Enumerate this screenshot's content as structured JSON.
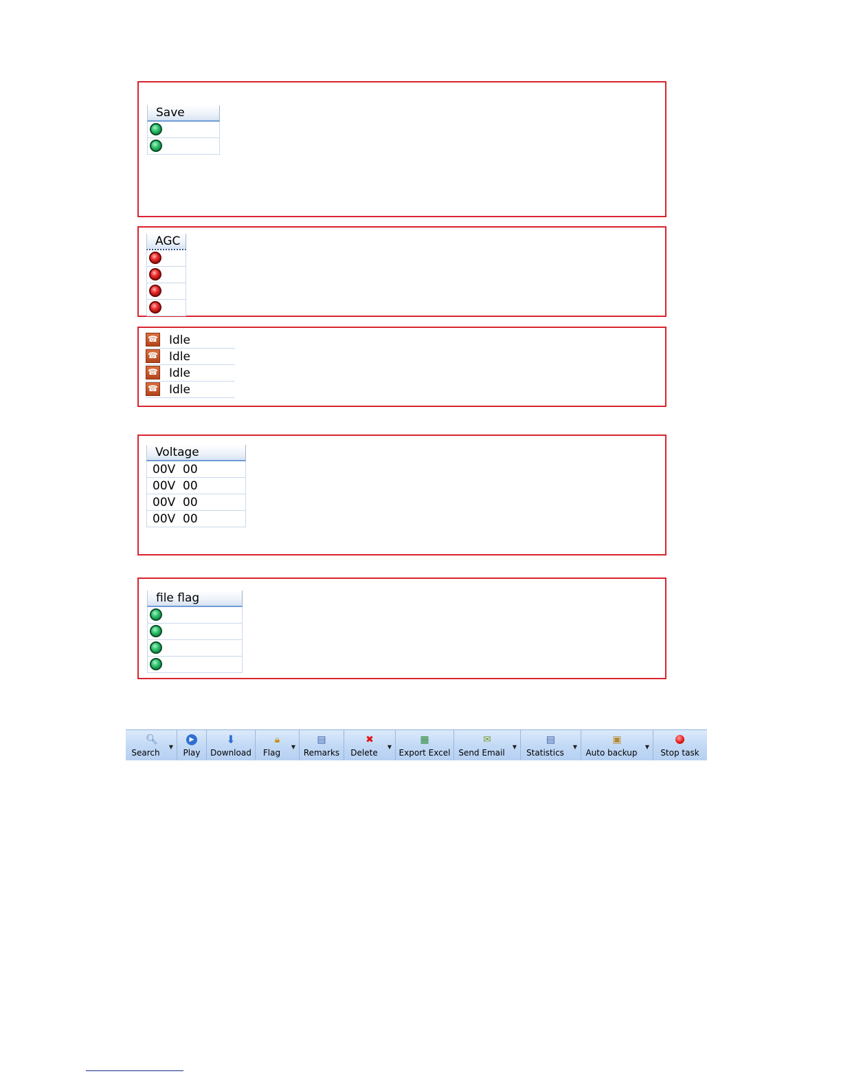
{
  "save_panel": {
    "header": "Save",
    "rows": [
      "green",
      "green"
    ]
  },
  "agc_panel": {
    "header": "AGC",
    "rows": [
      "red",
      "red",
      "red",
      "red"
    ]
  },
  "status_panel": {
    "rows": [
      "Idle",
      "Idle",
      "Idle",
      "Idle"
    ]
  },
  "voltage_panel": {
    "header": "Voltage",
    "rows": [
      {
        "volt": "00V",
        "val": "00"
      },
      {
        "volt": "00V",
        "val": "00"
      },
      {
        "volt": "00V",
        "val": "00"
      },
      {
        "volt": "00V",
        "val": "00"
      }
    ]
  },
  "fileflag_panel": {
    "header": "file flag",
    "rows": [
      "green",
      "green",
      "green",
      "green"
    ]
  },
  "toolbar": {
    "buttons": [
      {
        "label": "Search",
        "icon": "magnifier-icon",
        "dropdown": true
      },
      {
        "label": "Play",
        "icon": "play-icon",
        "dropdown": false
      },
      {
        "label": "Download",
        "icon": "download-arrow-icon",
        "dropdown": false
      },
      {
        "label": "Flag",
        "icon": "lock-icon",
        "dropdown": true
      },
      {
        "label": "Remarks",
        "icon": "notebook-icon",
        "dropdown": false
      },
      {
        "label": "Delete",
        "icon": "red-x-icon",
        "dropdown": true
      },
      {
        "label": "Export Excel",
        "icon": "excel-icon",
        "dropdown": false
      },
      {
        "label": "Send Email",
        "icon": "email-icon",
        "dropdown": true
      },
      {
        "label": "Statistics",
        "icon": "statistics-icon",
        "dropdown": true
      },
      {
        "label": "Auto backup",
        "icon": "backup-icon",
        "dropdown": true
      },
      {
        "label": "Stop task",
        "icon": "stop-icon",
        "dropdown": false
      }
    ]
  },
  "colors": {
    "panel_border": "#d9232e",
    "header_underline": "#6f9bd6",
    "toolbar_bg": "#c3daf6",
    "led_green": "#2fc46e",
    "led_red": "#ec2a2a",
    "phone_icon": "#c85a2c"
  }
}
